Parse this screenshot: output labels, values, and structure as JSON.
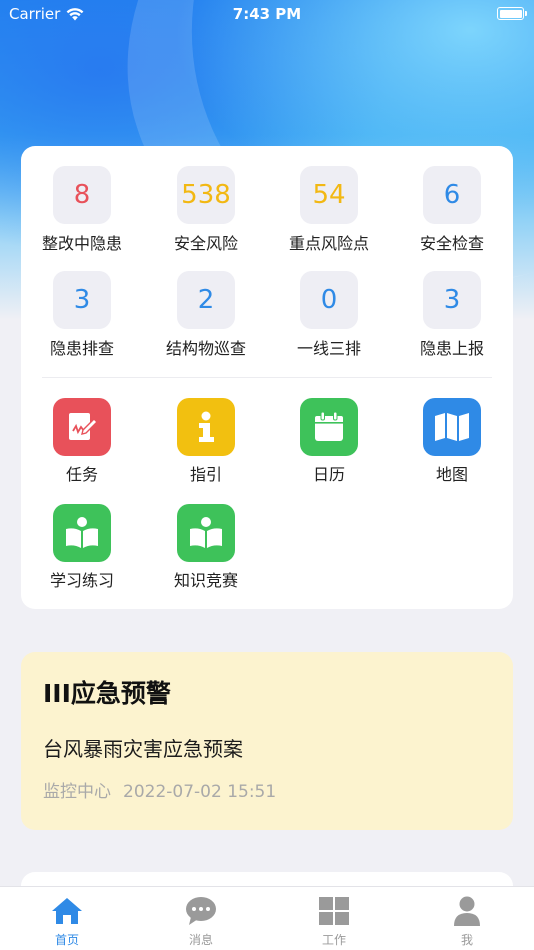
{
  "status_bar": {
    "carrier": "Carrier",
    "time": "7:43 PM"
  },
  "stats": [
    {
      "value": "8",
      "label": "整改中隐患",
      "color": "red"
    },
    {
      "value": "538",
      "label": "安全风险",
      "color": "yellow"
    },
    {
      "value": "54",
      "label": "重点风险点",
      "color": "yellow"
    },
    {
      "value": "6",
      "label": "安全检查",
      "color": "blue"
    },
    {
      "value": "3",
      "label": "隐患排查",
      "color": "blue"
    },
    {
      "value": "2",
      "label": "结构物巡查",
      "color": "blue"
    },
    {
      "value": "0",
      "label": "一线三排",
      "color": "blue"
    },
    {
      "value": "3",
      "label": "隐患上报",
      "color": "blue"
    }
  ],
  "apps": [
    {
      "label": "任务",
      "icon": "task-edit-icon",
      "bg": "#e8515a"
    },
    {
      "label": "指引",
      "icon": "info-icon",
      "bg": "#f2c010"
    },
    {
      "label": "日历",
      "icon": "calendar-icon",
      "bg": "#3ec25a"
    },
    {
      "label": "地图",
      "icon": "map-icon",
      "bg": "#2f8ae6"
    },
    {
      "label": "学习练习",
      "icon": "reading-icon",
      "bg": "#3ec25a"
    },
    {
      "label": "知识竞赛",
      "icon": "reading-icon",
      "bg": "#3ec25a"
    }
  ],
  "alert": {
    "title": "III应急预警",
    "item_title": "台风暴雨灾害应急预案",
    "source": "监控中心",
    "time": "2022-07-02 15:51"
  },
  "tabbar": [
    {
      "label": "首页",
      "icon": "home-icon",
      "active": true
    },
    {
      "label": "消息",
      "icon": "message-icon",
      "active": false
    },
    {
      "label": "工作",
      "icon": "grid-icon",
      "active": false
    },
    {
      "label": "我",
      "icon": "user-icon",
      "active": false
    }
  ],
  "colors": {
    "accent": "#2f8ae6",
    "red": "#e8515a",
    "yellow": "#f2b813",
    "alert_bg": "#fcf3cf"
  }
}
